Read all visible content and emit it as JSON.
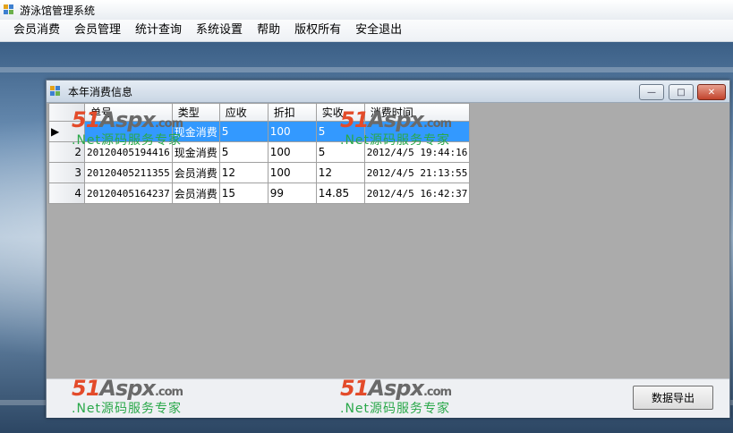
{
  "app": {
    "title": "游泳馆管理系统"
  },
  "menu": [
    "会员消费",
    "会员管理",
    "统计查询",
    "系统设置",
    "帮助",
    "版权所有",
    "安全退出"
  ],
  "child_window": {
    "title": "本年消费信息",
    "buttons": {
      "minimize": "—",
      "maximize": "□",
      "close": "✕"
    }
  },
  "grid": {
    "columns": [
      "单号",
      "类型",
      "应收",
      "折扣",
      "实收",
      "消费时间"
    ],
    "rows": [
      {
        "index": "",
        "cells": [
          "",
          "现金消费",
          "5",
          "100",
          "5",
          ""
        ],
        "selected": true
      },
      {
        "index": "2",
        "cells": [
          "20120405194416",
          "现金消费",
          "5",
          "100",
          "5",
          "2012/4/5 19:44:16"
        ],
        "selected": false
      },
      {
        "index": "3",
        "cells": [
          "20120405211355",
          "会员消费",
          "12",
          "100",
          "12",
          "2012/4/5 21:13:55"
        ],
        "selected": false
      },
      {
        "index": "4",
        "cells": [
          "20120405164237",
          "会员消费",
          "15",
          "99",
          "14.85",
          "2012/4/5 16:42:37"
        ],
        "selected": false
      }
    ]
  },
  "export_button": {
    "label": "数据导出"
  },
  "watermark": {
    "brand_num": "51",
    "brand_text": "Aspx",
    "brand_suffix": ".com",
    "tagline": ".Net源码服务专家"
  },
  "colors": {
    "selection": "#3399ff",
    "grid_background": "#ababab",
    "accent_red": "#e34b2a",
    "accent_green": "#2aa84a"
  }
}
